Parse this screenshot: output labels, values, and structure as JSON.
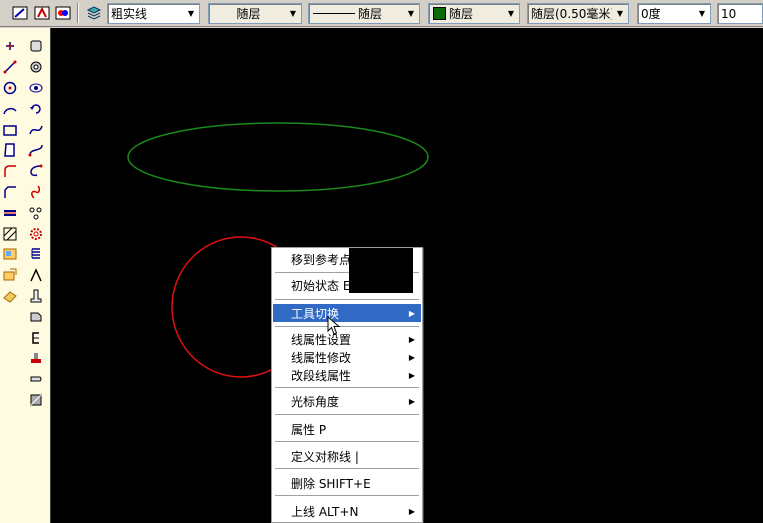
{
  "toolbar": {
    "linetype_combo": "粗实线",
    "layer_combo": "随层",
    "line_combo": "随层",
    "color_combo": "随层",
    "lineweight_combo": "随层(0.50毫米)",
    "angle_combo": "0度",
    "value_combo": "10",
    "color_swatch": "#0a6a0a"
  },
  "colors": {
    "canvas": "#000000",
    "ellipse": "#1a8a1a",
    "circle": "#e01010",
    "menu_highlight": "#316ac5"
  },
  "context_menu": {
    "items": [
      {
        "label": "移到参考点"
      },
      {
        "label": "初始状态 E"
      },
      {
        "label": "工具切换",
        "submenu": true,
        "selected": true
      },
      {
        "label": "线属性设置",
        "submenu": true
      },
      {
        "label": "线属性修改",
        "submenu": true
      },
      {
        "label": "改段线属性",
        "submenu": true
      },
      {
        "label": "光标角度",
        "submenu": true
      },
      {
        "label": "属性 P"
      },
      {
        "label": "定义对称线 |"
      },
      {
        "label": "删除 SHIFT+E"
      },
      {
        "label": "上线 ALT+N",
        "submenu": true
      }
    ]
  },
  "left_toolbar": {
    "col1_icons": [
      "point-icon",
      "line-icon",
      "circle-icon",
      "arc-icon",
      "rectangle-icon",
      "polygon-icon",
      "fillet-icon",
      "chamfer-icon",
      "spring-icon",
      "hatch-icon",
      "block-icon",
      "insert-icon",
      "eraser-icon"
    ],
    "col2_icons": [
      "box-icon",
      "view-icon",
      "eye-icon",
      "rotate-icon",
      "curve-icon",
      "spline-icon",
      "spiral-icon",
      "hook-icon",
      "dots-icon",
      "gear-icon",
      "coil-icon",
      "arch-icon",
      "pillar-icon",
      "step-icon",
      "bracket-icon",
      "base-icon",
      "cap-icon",
      "square-icon"
    ]
  }
}
